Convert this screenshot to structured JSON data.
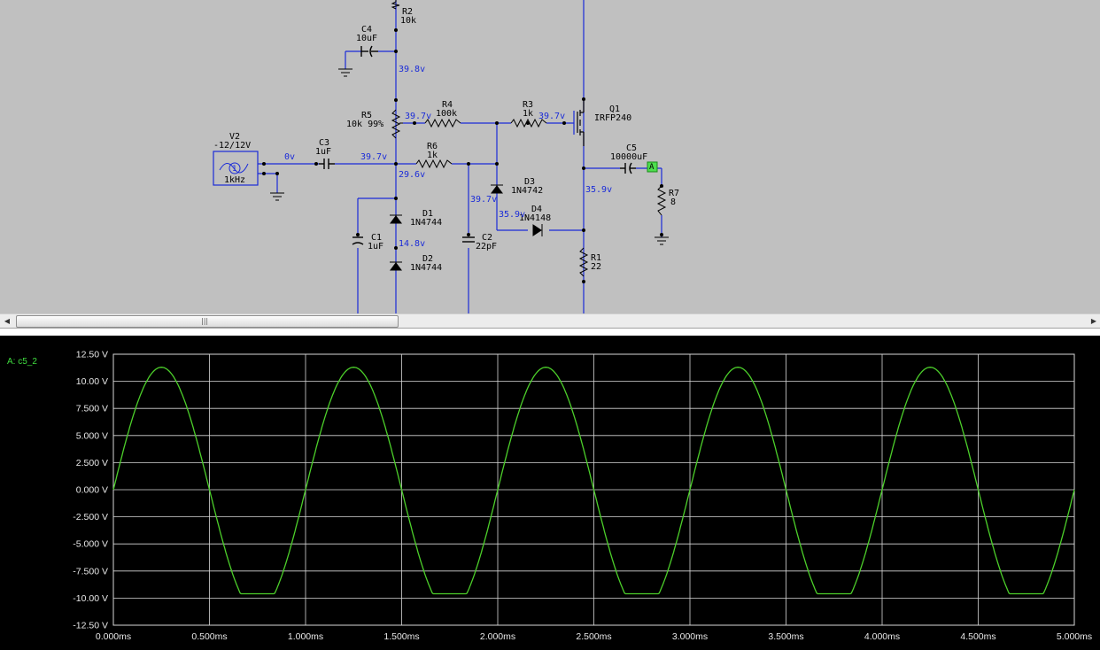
{
  "schematic": {
    "components": {
      "r2": {
        "name": "R2",
        "value": "10k"
      },
      "c4": {
        "name": "C4",
        "value": "10uF"
      },
      "r5": {
        "name": "R5",
        "value": "10k 99%"
      },
      "r4": {
        "name": "R4",
        "value": "100k"
      },
      "r3": {
        "name": "R3",
        "value": "1k"
      },
      "q1": {
        "name": "Q1",
        "value": "IRFP240"
      },
      "v2": {
        "name": "V2",
        "value": "-12/12V",
        "freq": "1kHz",
        "index": "1"
      },
      "c3": {
        "name": "C3",
        "value": "1uF"
      },
      "r6": {
        "name": "R6",
        "value": "1k"
      },
      "c5": {
        "name": "C5",
        "value": "10000uF"
      },
      "r7": {
        "name": "R7",
        "value": "8"
      },
      "d3": {
        "name": "D3",
        "value": "1N4742"
      },
      "d4": {
        "name": "D4",
        "value": "1N4148"
      },
      "d1": {
        "name": "D1",
        "value": "1N4744"
      },
      "d2": {
        "name": "D2",
        "value": "1N4744"
      },
      "c1": {
        "name": "C1",
        "value": "1uF"
      },
      "c2": {
        "name": "C2",
        "value": "22pF"
      },
      "r1": {
        "name": "R1",
        "value": "22"
      }
    },
    "probe_label": "A",
    "voltages": {
      "r2_node": "39.8v",
      "r5_wiper": "39.7v",
      "gate": "39.7v",
      "input": "0v",
      "c3_node": "39.7v",
      "zener_top": "29.6v",
      "d3_node": "39.7v",
      "d4_node": "35.9v",
      "source": "35.9v",
      "mid_zener": "14.8v"
    }
  },
  "scrollbar": {
    "left_arrow": "◀",
    "right_arrow": "▶",
    "grip": "|||"
  },
  "scope": {
    "trace_label": "A: c5_2",
    "trace_color": "#4ccf2a",
    "grid_color": "#d8d8d8",
    "background": "#000000"
  },
  "chart_data": {
    "type": "line",
    "title": "",
    "xlabel": "",
    "ylabel": "",
    "xlim": [
      0,
      5.0
    ],
    "ylim": [
      -12.5,
      12.5
    ],
    "x_ticks": [
      0.0,
      0.5,
      1.0,
      1.5,
      2.0,
      2.5,
      3.0,
      3.5,
      4.0,
      4.5,
      5.0
    ],
    "x_tick_labels": [
      "0.000ms",
      "0.500ms",
      "1.000ms",
      "1.500ms",
      "2.000ms",
      "2.500ms",
      "3.000ms",
      "3.500ms",
      "4.000ms",
      "4.500ms",
      "5.000ms"
    ],
    "y_ticks": [
      12.5,
      10.0,
      7.5,
      5.0,
      2.5,
      0.0,
      -2.5,
      -5.0,
      -7.5,
      -10.0,
      -12.5
    ],
    "y_tick_labels": [
      "12.50 V",
      "10.00 V",
      "7.500 V",
      "5.000 V",
      "2.500 V",
      "0.000 V",
      "-2.500 V",
      "-5.000 V",
      "-7.500 V",
      "-10.00 V",
      "-12.50 V"
    ],
    "grid": true,
    "series": [
      {
        "name": "A: c5_2",
        "frequency_khz": 1.0,
        "positive_peak": 11.3,
        "negative_clip": -9.6,
        "x": [
          0.0,
          0.05,
          0.1,
          0.15,
          0.2,
          0.25,
          0.3,
          0.35,
          0.4,
          0.45,
          0.5,
          0.55,
          0.6,
          0.65,
          0.7,
          0.75,
          0.8,
          0.85,
          0.9,
          0.95,
          1.0,
          1.05,
          1.1,
          1.15,
          1.2,
          1.25,
          1.3,
          1.35,
          1.4,
          1.45,
          1.5,
          1.55,
          1.6,
          1.65,
          1.7,
          1.75,
          1.8,
          1.85,
          1.9,
          1.95,
          2.0,
          2.05,
          2.1,
          2.15,
          2.2,
          2.25,
          2.3,
          2.35,
          2.4,
          2.45,
          2.5,
          2.55,
          2.6,
          2.65,
          2.7,
          2.75,
          2.8,
          2.85,
          2.9,
          2.95,
          3.0,
          3.05,
          3.1,
          3.15,
          3.2,
          3.25,
          3.3,
          3.35,
          3.4,
          3.45,
          3.5,
          3.55,
          3.6,
          3.65,
          3.7,
          3.75,
          3.8,
          3.85,
          3.9,
          3.95,
          4.0,
          4.05,
          4.1,
          4.15,
          4.2,
          4.25,
          4.3,
          4.35,
          4.4,
          4.45,
          4.5,
          4.55,
          4.6,
          4.65,
          4.7,
          4.75,
          4.8,
          4.85,
          4.9,
          4.95,
          5.0
        ],
        "y": [
          0.0,
          3.49,
          6.64,
          9.14,
          10.75,
          11.3,
          10.75,
          9.14,
          6.64,
          3.49,
          0.0,
          -3.49,
          -6.64,
          -9.14,
          -9.6,
          -9.6,
          -9.6,
          -9.14,
          -6.64,
          -3.49,
          0.0,
          3.49,
          6.64,
          9.14,
          10.75,
          11.3,
          10.75,
          9.14,
          6.64,
          3.49,
          0.0,
          -3.49,
          -6.64,
          -9.14,
          -9.6,
          -9.6,
          -9.6,
          -9.14,
          -6.64,
          -3.49,
          0.0,
          3.49,
          6.64,
          9.14,
          10.75,
          11.3,
          10.75,
          9.14,
          6.64,
          3.49,
          0.0,
          -3.49,
          -6.64,
          -9.14,
          -9.6,
          -9.6,
          -9.6,
          -9.14,
          -6.64,
          -3.49,
          0.0,
          3.49,
          6.64,
          9.14,
          10.75,
          11.3,
          10.75,
          9.14,
          6.64,
          3.49,
          0.0,
          -3.49,
          -6.64,
          -9.14,
          -9.6,
          -9.6,
          -9.6,
          -9.14,
          -6.64,
          -3.49,
          0.0,
          3.49,
          6.64,
          9.14,
          10.75,
          11.3,
          10.75,
          9.14,
          6.64,
          3.49,
          0.0,
          -3.49,
          -6.64,
          -9.14,
          -9.6,
          -9.6,
          -9.6,
          -9.14,
          -6.64,
          -3.49,
          0.0
        ]
      }
    ]
  }
}
